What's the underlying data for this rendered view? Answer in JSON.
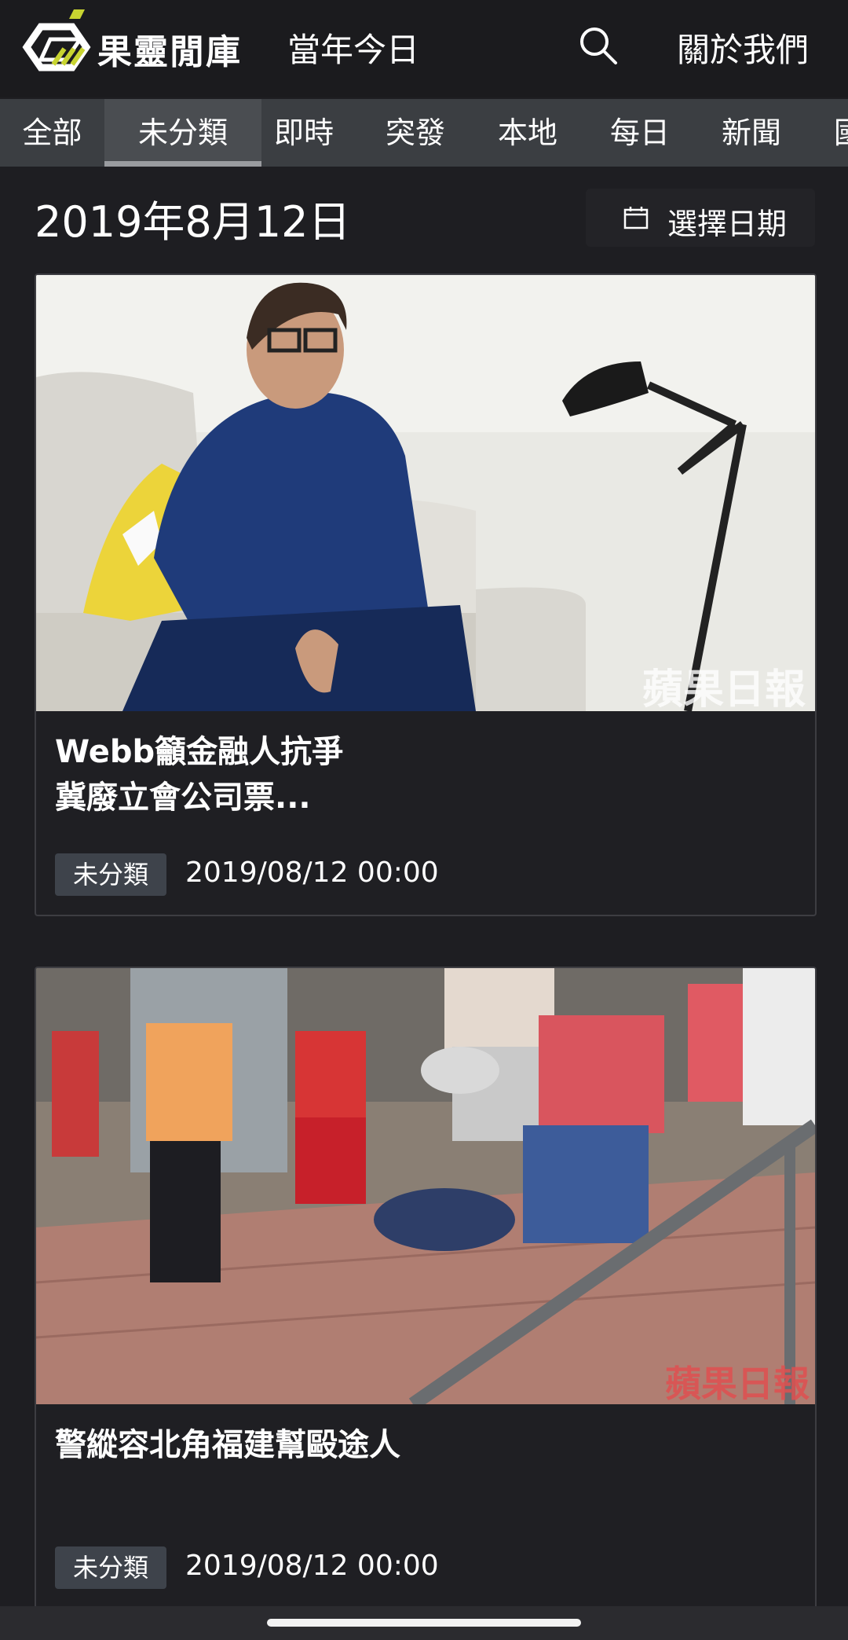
{
  "header": {
    "brand": "果靈閒庫",
    "today_label": "當年今日",
    "about_label": "關於我們",
    "search_icon": "search-icon"
  },
  "tabs": [
    {
      "label": "全部"
    },
    {
      "label": "未分類",
      "active": true
    },
    {
      "label": "即時"
    },
    {
      "label": "突發"
    },
    {
      "label": "本地"
    },
    {
      "label": "每日"
    },
    {
      "label": "新聞"
    },
    {
      "label": "國"
    }
  ],
  "date": {
    "title": "2019年8月12日",
    "picker_label": "選擇日期",
    "picker_icon": "calendar-icon"
  },
  "articles": [
    {
      "title_line1": "Webb籲金融人抗爭",
      "title_line2": "冀廢立會公司票...",
      "category": "未分類",
      "timestamp": "2019/08/12 00:00",
      "watermark": "蘋果日報"
    },
    {
      "title_line1": "警縱容北角福建幫毆途人",
      "category": "未分類",
      "timestamp": "2019/08/12 00:00",
      "watermark": "蘋果日報"
    }
  ],
  "colors": {
    "background": "#1e1e22",
    "tabbar": "#3b3e42",
    "badge": "#3e434b",
    "logo_accent": "#c8d431"
  }
}
